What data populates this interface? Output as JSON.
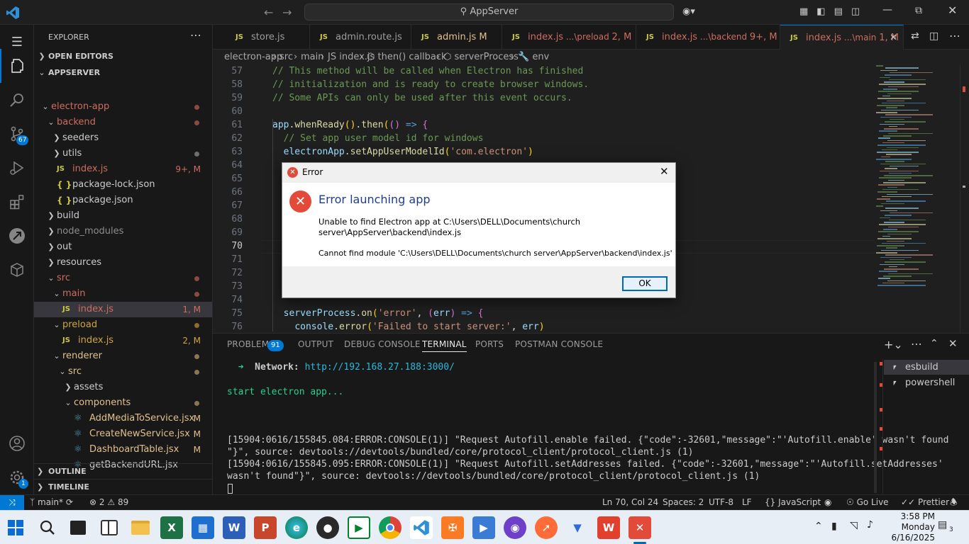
{
  "titlebar": {
    "search_text": "AppServer"
  },
  "activity": {
    "scm_badge": "67",
    "settings_badge": "1"
  },
  "explorer": {
    "title": "EXPLORER",
    "open_editors": "OPEN EDITORS",
    "root": "APPSERVER",
    "items": [
      {
        "label": "electron-app",
        "type": "folder",
        "open": true,
        "color": "#cc6d5e"
      },
      {
        "label": "backend",
        "type": "folder",
        "open": true,
        "color": "#cc6d5e"
      },
      {
        "label": "seeders",
        "type": "folder",
        "open": false
      },
      {
        "label": "utils",
        "type": "folder",
        "open": false
      },
      {
        "label": "index.js",
        "type": "js",
        "badge": "9+, M",
        "color": "#cc6d5e"
      },
      {
        "label": "package-lock.json",
        "type": "json"
      },
      {
        "label": "package.json",
        "type": "json"
      },
      {
        "label": "build",
        "type": "folder",
        "open": false
      },
      {
        "label": "node_modules",
        "type": "folder",
        "open": false
      },
      {
        "label": "out",
        "type": "folder",
        "open": false
      },
      {
        "label": "resources",
        "type": "folder",
        "open": false
      },
      {
        "label": "src",
        "type": "folder",
        "open": true,
        "color": "#cc6d5e"
      },
      {
        "label": "main",
        "type": "folder",
        "open": true,
        "color": "#cc6d5e"
      },
      {
        "label": "index.js",
        "type": "js",
        "badge": "1, M",
        "color": "#cc6d5e"
      },
      {
        "label": "preload",
        "type": "folder",
        "open": true,
        "color": "#d0a53b"
      },
      {
        "label": "index.js",
        "type": "js",
        "badge": "2, M",
        "color": "#d0a53b"
      },
      {
        "label": "renderer",
        "type": "folder",
        "open": true,
        "color": "#e2c08d"
      },
      {
        "label": "src",
        "type": "folder",
        "open": true,
        "color": "#e2c08d"
      },
      {
        "label": "assets",
        "type": "folder",
        "open": false
      },
      {
        "label": "components",
        "type": "folder",
        "open": true,
        "color": "#e2c08d"
      },
      {
        "label": "AddMediaToService.jsx",
        "type": "react",
        "badge": "M",
        "color": "#e2c08d"
      },
      {
        "label": "CreateNewService.jsx",
        "type": "react",
        "badge": "M",
        "color": "#e2c08d"
      },
      {
        "label": "DashboardTable.jsx",
        "type": "react",
        "badge": "M",
        "color": "#e2c08d"
      },
      {
        "label": "getBackendURL.jsx",
        "type": "react"
      }
    ],
    "outline": "OUTLINE",
    "timeline": "TIMELINE"
  },
  "tabs": [
    {
      "name": "store.js",
      "desc": "",
      "badge": ""
    },
    {
      "name": "admin.route.js",
      "desc": "",
      "badge": ""
    },
    {
      "name": "admin.js",
      "desc": "",
      "badge": "M"
    },
    {
      "name": "index.js",
      "desc": "...\\preload",
      "badge": "2, M"
    },
    {
      "name": "index.js",
      "desc": "...\\backend",
      "badge": "9+, M"
    },
    {
      "name": "index.js",
      "desc": "...\\main",
      "badge": "1, M"
    }
  ],
  "breadcrumb": [
    "electron-app",
    "src",
    "main",
    "index.js",
    "then() callback",
    "serverProcess",
    "env"
  ],
  "code_lines": [
    {
      "n": "57",
      "html": "<span class='cm'>// This method will be called when Electron has finished</span>"
    },
    {
      "n": "58",
      "html": "<span class='cm'>// initialization and is ready to create browser windows.</span>"
    },
    {
      "n": "59",
      "html": "<span class='cm'>// Some APIs can only be used after this event occurs.</span>"
    },
    {
      "n": "60",
      "html": ""
    },
    {
      "n": "61",
      "html": "<span class='vr'>app</span><span class='pl'>.</span><span class='fn'>whenReady</span><span class='br'>()</span><span class='pl'>.</span><span class='fn'>then</span><span class='br'>(</span><span class='br2'>()</span> <span class='kw'>=&gt;</span> <span class='br2'>{</span>"
    },
    {
      "n": "62",
      "html": "  <span class='cm'>// Set app user model id for windows</span>"
    },
    {
      "n": "63",
      "html": "  <span class='vr'>electronApp</span><span class='pl'>.</span><span class='fn'>setAppUserModelId</span><span class='br'>(</span><span class='st'>'com.electron'</span><span class='br'>)</span>"
    },
    {
      "n": "64",
      "html": ""
    },
    {
      "n": "65",
      "html": ""
    },
    {
      "n": "66",
      "html": ""
    },
    {
      "n": "67",
      "html": "                                                      <span class='st'>')</span><span class='br2'>]</span><span class='pl'>,</span> <span class='br2'>{</span>"
    },
    {
      "n": "68",
      "html": ""
    },
    {
      "n": "69",
      "html": ""
    },
    {
      "n": "70",
      "html": ""
    },
    {
      "n": "71",
      "html": ""
    },
    {
      "n": "72",
      "html": ""
    },
    {
      "n": "73",
      "html": ""
    },
    {
      "n": "74",
      "html": ""
    },
    {
      "n": "75",
      "html": "  <span class='vr'>serverProcess</span><span class='pl'>.</span><span class='fn'>on</span><span class='br'>(</span><span class='st'>'error'</span><span class='pl'>,</span> <span class='br2'>(</span><span class='vr'>err</span><span class='br2'>)</span> <span class='kw'>=&gt;</span> <span class='br2'>{</span>"
    },
    {
      "n": "76",
      "html": "    <span class='vr'>console</span><span class='pl'>.</span><span class='fn'>error</span><span class='br'>(</span><span class='st'>'Failed to start server:'</span><span class='pl'>,</span> <span class='vr'>err</span><span class='br'>)</span>"
    }
  ],
  "panel": {
    "tabs": [
      "PROBLEMS",
      "OUTPUT",
      "DEBUG CONSOLE",
      "TERMINAL",
      "PORTS",
      "POSTMAN CONSOLE"
    ],
    "problems_count": "91",
    "network_label": "Network:",
    "network_url": "http://192.168.27.188:3000/",
    "start_line": "start electron app...",
    "log1a": "[15904:0616/155845.084:ERROR:CONSOLE(1)] \"Request Autofill.enable failed. {\"code\":-32601,\"message\":\"'Autofill.enable' wasn't found",
    "log1b": "\"}\", source: devtools://devtools/bundled/core/protocol_client/protocol_client.js (1)",
    "log2a": "[15904:0616/155845.095:ERROR:CONSOLE(1)] \"Request Autofill.setAddresses failed. {\"code\":-32601,\"message\":\"'Autofill.setAddresses'",
    "log2b": "wasn't found\"}\", source: devtools://devtools/bundled/core/protocol_client/protocol_client.js (1)",
    "terminals": [
      "esbuild",
      "powershell"
    ]
  },
  "status": {
    "branch": "main*",
    "errors": "2",
    "warnings": "89",
    "position": "Ln 70, Col 24",
    "spaces": "Spaces: 2",
    "encoding": "UTF-8",
    "eol": "LF",
    "language": "JavaScript",
    "golive": "Go Live",
    "prettier": "Prettier"
  },
  "dialog": {
    "title": "Error",
    "heading": "Error launching app",
    "line1": "Unable to find Electron app at C:\\Users\\DELL\\Documents\\church",
    "line2": "server\\AppServer\\backend\\index.js",
    "line3": "Cannot find module 'C:\\Users\\DELL\\Documents\\church server\\AppServer\\backend\\index.js'",
    "ok": "OK"
  },
  "taskbar": {
    "time": "3:58 PM",
    "day": "Monday",
    "date": "6/16/2025",
    "notif_count": "3"
  }
}
